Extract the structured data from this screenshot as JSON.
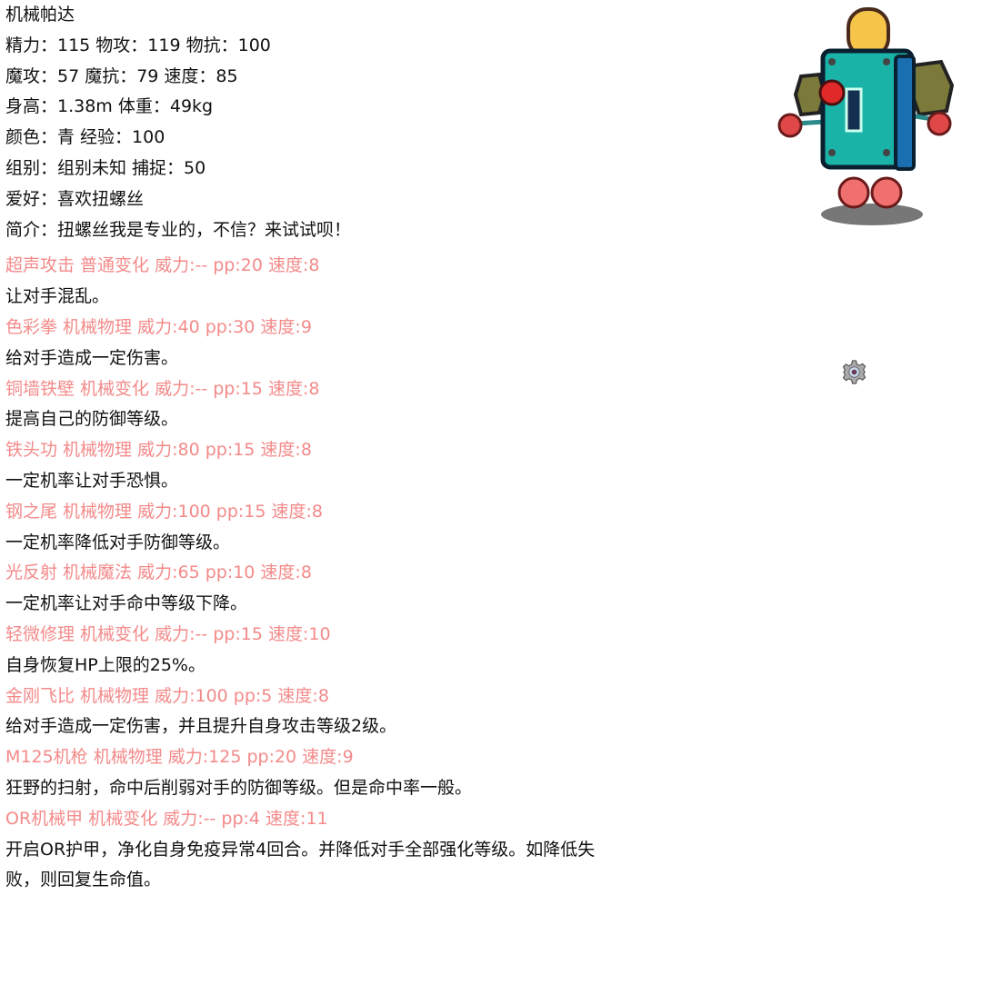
{
  "profile": {
    "name": "机械帕达",
    "lines": [
      "精力：115 物攻：119 物抗：100",
      "魔攻：57 魔抗：79 速度：85",
      "身高：1.38m 体重：49kg",
      "颜色：青 经验：100",
      "组别：组别未知 捕捉：50",
      "爱好：喜欢扭螺丝",
      "简介：扭螺丝我是专业的，不信？来试试呗！"
    ]
  },
  "skills": [
    {
      "header": "超声攻击 普通变化 威力:-- pp:20 速度:8",
      "desc": "让对手混乱。"
    },
    {
      "header": "色彩拳 机械物理 威力:40 pp:30 速度:9",
      "desc": "给对手造成一定伤害。"
    },
    {
      "header": "铜墙铁壁 机械变化 威力:-- pp:15 速度:8",
      "desc": "提高自己的防御等级。"
    },
    {
      "header": "铁头功 机械物理 威力:80 pp:15 速度:8",
      "desc": "一定机率让对手恐惧。"
    },
    {
      "header": "钢之尾 机械物理 威力:100 pp:15 速度:8",
      "desc": "一定机率降低对手防御等级。"
    },
    {
      "header": "光反射 机械魔法 威力:65 pp:10 速度:8",
      "desc": "一定机率让对手命中等级下降。"
    },
    {
      "header": "轻微修理 机械变化 威力:-- pp:15 速度:10",
      "desc": "自身恢复HP上限的25%。"
    },
    {
      "header": "金刚飞比 机械物理 威力:100 pp:5 速度:8",
      "desc": "给对手造成一定伤害，并且提升自身攻击等级2级。"
    },
    {
      "header": "M125机枪 机械物理 威力:125 pp:20 速度:9",
      "desc": "狂野的扫射，命中后削弱对手的防御等级。但是命中率一般。"
    },
    {
      "header": "OR机械甲 机械变化 威力:-- pp:4 速度:11",
      "desc": "开启OR护甲，净化自身免疫异常4回合。并降低对手全部强化等级。如降低失败，则回复生命值。"
    }
  ],
  "colors": {
    "skill_header": "#f48a8a",
    "text": "#111111"
  },
  "icons": {
    "robot": "robot-pet-image",
    "gear": "gear-icon"
  }
}
